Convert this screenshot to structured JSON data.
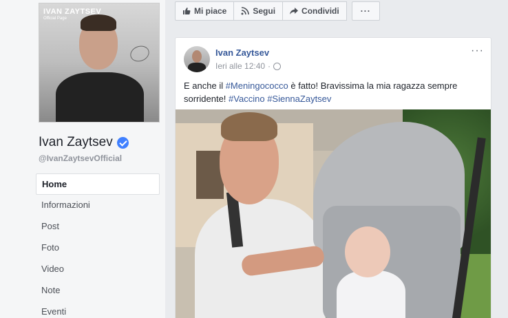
{
  "page": {
    "name": "Ivan Zaytsev",
    "handle": "@IvanZaytsevOfficial",
    "cover_brand": "IVAN ZAYTSEV",
    "cover_sub": "Official Page"
  },
  "nav": {
    "items": [
      {
        "label": "Home",
        "active": true
      },
      {
        "label": "Informazioni"
      },
      {
        "label": "Post"
      },
      {
        "label": "Foto"
      },
      {
        "label": "Video"
      },
      {
        "label": "Note"
      },
      {
        "label": "Eventi"
      }
    ]
  },
  "actions": {
    "like": "Mi piace",
    "follow": "Segui",
    "share": "Condividi",
    "more": "···"
  },
  "post": {
    "author": "Ivan Zaytsev",
    "timestamp": "Ieri alle 12:40",
    "menu": "···",
    "text_1": "E anche il ",
    "tag_1": "#Meningococco",
    "text_2": " è fatto! Bravissima la mia ragazza sempre sorridente! ",
    "tag_2": "#Vaccino",
    "tag_3": "#SiennaZaytsev"
  },
  "colors": {
    "link": "#365899",
    "verified": "#4080ff",
    "background": "#e9ebee"
  }
}
